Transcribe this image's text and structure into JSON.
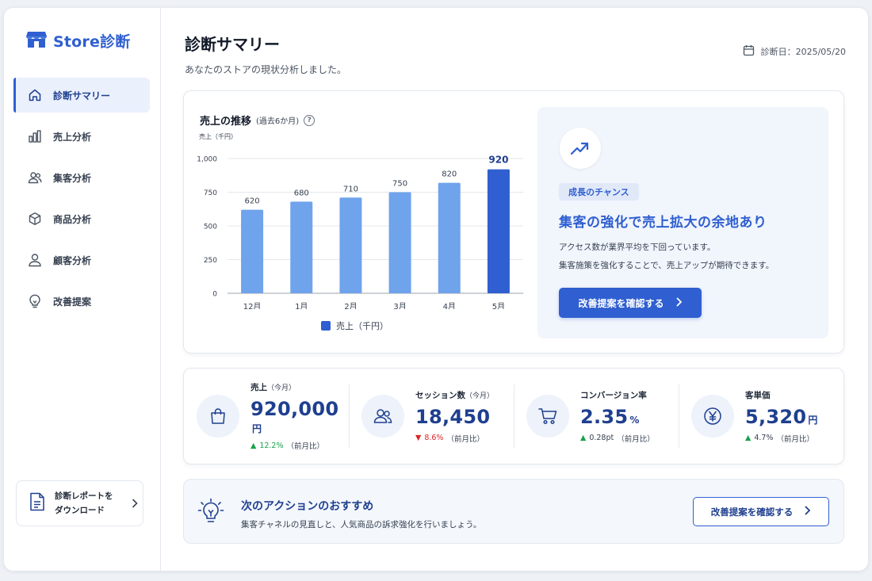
{
  "brand": {
    "name": "Store診断",
    "icon": "store-icon"
  },
  "sidebar": {
    "items": [
      {
        "label": "診断サマリー",
        "icon": "home-icon",
        "active": true
      },
      {
        "label": "売上分析",
        "icon": "bar-chart-icon"
      },
      {
        "label": "集客分析",
        "icon": "users-icon"
      },
      {
        "label": "商品分析",
        "icon": "box-icon"
      },
      {
        "label": "顧客分析",
        "icon": "user-icon"
      },
      {
        "label": "改善提案",
        "icon": "lightbulb-icon"
      }
    ],
    "download": {
      "line1": "診断レポートを",
      "line2": "ダウンロード",
      "icon": "document-icon"
    }
  },
  "header": {
    "title": "診断サマリー",
    "subtitle": "あなたのストアの現状分析しました。",
    "date_label": "診断日：2025/05/20"
  },
  "chart_card": {
    "title": "売上の推移",
    "title_note": "(過去6か月)",
    "help": "?"
  },
  "chart_data": {
    "type": "bar",
    "title": "売上の推移",
    "ylabel": "売上（千円）",
    "categories": [
      "12月",
      "1月",
      "2月",
      "3月",
      "4月",
      "5月"
    ],
    "series": [
      {
        "name": "売上（千円）",
        "values": [
          620,
          680,
          710,
          750,
          820,
          920
        ]
      }
    ],
    "yticks": [
      "1,000",
      "750",
      "500",
      "250",
      "0"
    ],
    "ylim": [
      0,
      1000
    ],
    "grid": true,
    "highlight_index": 5,
    "colors": {
      "bar": "#6fa3ec",
      "highlight": "#2f5fd0"
    }
  },
  "insight": {
    "icon": "trend-up-icon",
    "badge": "成長のチャンス",
    "headline": "集客の強化で売上拡大の余地あり",
    "line1": "アクセス数が業界平均を下回っています。",
    "line2": "集客施策を強化することで、売上アップが期待できます。",
    "cta": "改善提案を確認する"
  },
  "kpis": [
    {
      "label": "売上",
      "note": "（今月）",
      "value": "920,000",
      "unit": "円",
      "delta": "12.2%",
      "delta_note": "（前月比）",
      "dir": "up",
      "icon": "shopping-bag-icon"
    },
    {
      "label": "セッション数",
      "note": "（今月）",
      "value": "18,450",
      "unit": "",
      "delta": "8.6%",
      "delta_note": "（前月比）",
      "dir": "down",
      "icon": "users-icon"
    },
    {
      "label": "コンバージョン率",
      "note": "",
      "value": "2.35",
      "unit": "%",
      "delta": "0.28pt",
      "delta_note": "（前月比）",
      "dir": "up",
      "icon": "cart-icon"
    },
    {
      "label": "客単価",
      "note": "",
      "value": "5,320",
      "unit": "円",
      "delta": "4.7%",
      "delta_note": "（前月比）",
      "dir": "up",
      "icon": "yen-icon"
    }
  ],
  "action": {
    "icon": "lightbulb-icon",
    "title": "次のアクションのおすすめ",
    "subtitle": "集客チャネルの見直しと、人気商品の訴求強化を行いましょう。",
    "button": "改善提案を確認する"
  },
  "colors": {
    "accent": "#2f5fd0",
    "up": "#16a34a",
    "down": "#dc2626"
  }
}
